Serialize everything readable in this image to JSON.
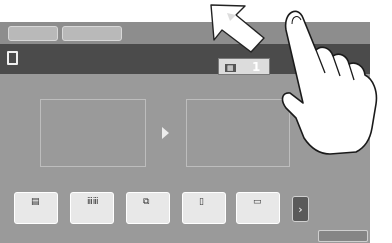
{
  "top_tabs": [
    {
      "label": "",
      "icon": "tab-icon"
    },
    {
      "label": "",
      "icon": "tab-icon"
    }
  ],
  "message": {
    "line1": "",
    "line2": "",
    "icon": "document-icon"
  },
  "counter": {
    "grid_icon": "▦",
    "value": "1"
  },
  "previews": {
    "left_label": "",
    "right_label": ""
  },
  "tools": [
    {
      "icon": "▤",
      "label": "",
      "caption": ""
    },
    {
      "icon": "ⅲⅲ",
      "label": "",
      "caption": ""
    },
    {
      "icon": "⧉",
      "label": "",
      "caption": ""
    },
    {
      "icon": "▯",
      "label": "",
      "caption": ""
    },
    {
      "icon": "▭",
      "label": "",
      "caption": ""
    }
  ],
  "next_glyph": "›",
  "corner_button": "",
  "overlay": {
    "gesture": "flick-up-left",
    "icon": "hand-pointer-icon",
    "arrow_color": "#ffffff",
    "outline_color": "#222222"
  }
}
